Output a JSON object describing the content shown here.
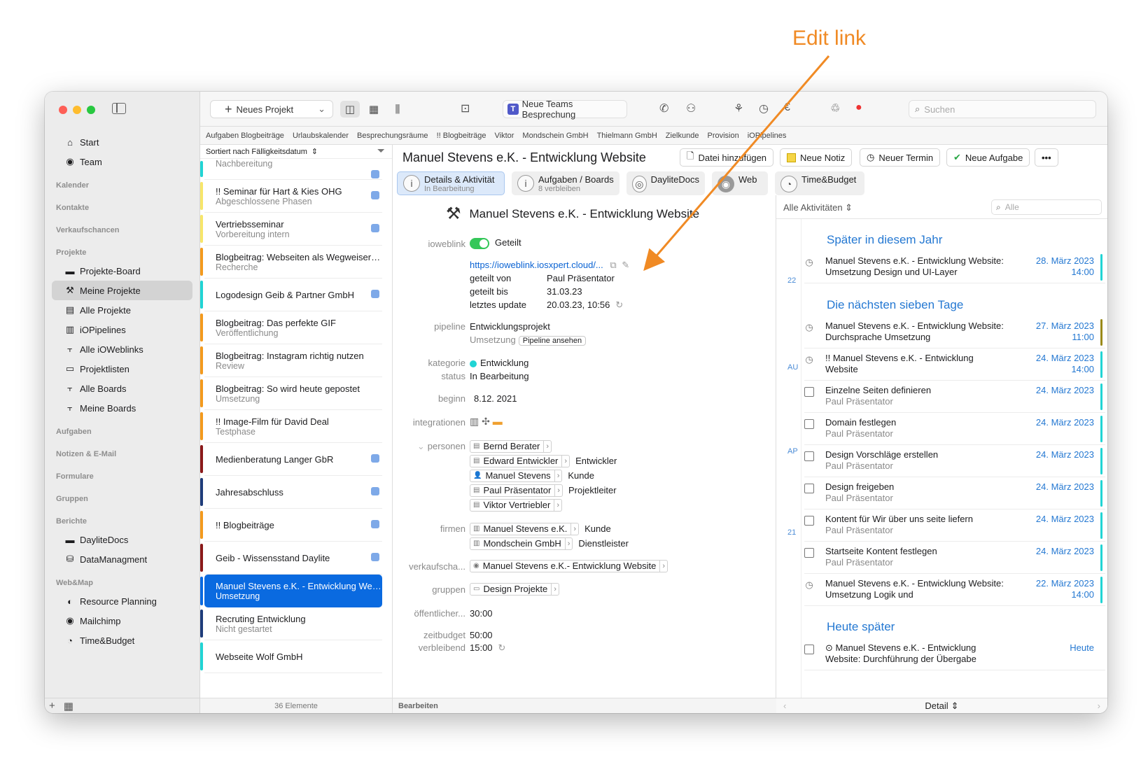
{
  "annotation": {
    "text": "Edit link"
  },
  "sidebar": {
    "items_top": [
      {
        "label": "Start",
        "icon": "home-icon"
      },
      {
        "label": "Team",
        "icon": "team-icon"
      }
    ],
    "headers": {
      "kalender": "Kalender",
      "kontakte": "Kontakte",
      "verkaufschancen": "Verkaufschancen",
      "projekte": "Projekte",
      "aufgaben": "Aufgaben",
      "notizen": "Notizen & E-Mail",
      "formulare": "Formulare",
      "gruppen": "Gruppen",
      "berichte": "Berichte",
      "webmap": "Web&Map"
    },
    "projekte": [
      {
        "label": "Projekte-Board"
      },
      {
        "label": "Meine Projekte"
      },
      {
        "label": "Alle Projekte"
      },
      {
        "label": "iOPipelines"
      },
      {
        "label": "Alle iOWeblinks"
      },
      {
        "label": "Projektlisten"
      },
      {
        "label": "Alle Boards"
      },
      {
        "label": "Meine Boards"
      }
    ],
    "berichte": [
      {
        "label": "DayliteDocs"
      },
      {
        "label": "DataManagment"
      }
    ],
    "webmap": [
      {
        "label": "Resource Planning"
      },
      {
        "label": "Mailchimp"
      },
      {
        "label": "Time&Budget"
      }
    ]
  },
  "toolbar": {
    "new_project": "Neues Projekt",
    "teams": "Neue Teams Besprechung",
    "search_placeholder": "Suchen"
  },
  "favorites": [
    "Aufgaben Blogbeiträge",
    "Urlaubskalender",
    "Besprechungsräume",
    "!! Blogbeiträge",
    "Viktor",
    "Mondschein GmbH",
    "Thielmann GmbH",
    "Zielkunde",
    "Provision",
    "iOPipelines"
  ],
  "list": {
    "sort": "Sortiert nach Fälligkeitsdatum",
    "footer": "36 Elemente",
    "rows": [
      {
        "t1": "",
        "t2": "Nachbereitung",
        "color": "#21d4d4",
        "badge": true
      },
      {
        "t1": "!! Seminar für Hart & Kies OHG",
        "t2": "Abgeschlossene Phasen",
        "color": "#f7e66b",
        "badge": true
      },
      {
        "t1": "Vertriebsseminar",
        "t2": "Vorbereitung intern",
        "color": "#f7e66b",
        "badge": true
      },
      {
        "t1": "Blogbeitrag: Webseiten als Wegweiser d...",
        "t2": "Recherche",
        "color": "#f39a1e",
        "badge": false
      },
      {
        "t1": "Logodesign Geib & Partner GmbH",
        "t2": "",
        "color": "#21d4d4",
        "badge": true
      },
      {
        "t1": "Blogbeitrag: Das perfekte GIF",
        "t2": "Veröffentlichung",
        "color": "#f39a1e",
        "badge": false
      },
      {
        "t1": "Blogbeitrag: Instagram richtig nutzen",
        "t2": "Review",
        "color": "#f39a1e",
        "badge": false
      },
      {
        "t1": "Blogbeitrag: So wird heute gepostet",
        "t2": "Umsetzung",
        "color": "#f39a1e",
        "badge": false
      },
      {
        "t1": "!! Image-Film für David Deal",
        "t2": "Testphase",
        "color": "#f39a1e",
        "badge": false
      },
      {
        "t1": "Medienberatung Langer GbR",
        "t2": "",
        "color": "#8b1a1a",
        "badge": true
      },
      {
        "t1": "Jahresabschluss",
        "t2": "",
        "color": "#1f3d7a",
        "badge": true
      },
      {
        "t1": "!! Blogbeiträge",
        "t2": "",
        "color": "#f39a1e",
        "badge": true
      },
      {
        "t1": "Geib - Wissensstand Daylite",
        "t2": "",
        "color": "#8b1a1a",
        "badge": true
      },
      {
        "t1": "Manuel Stevens e.K. - Entwicklung Webs...",
        "t2": "Umsetzung",
        "color": "#0a6ae0",
        "badge": false,
        "selected": true
      },
      {
        "t1": "Recruting Entwicklung",
        "t2": "Nicht gestartet",
        "color": "#1f3d7a",
        "badge": false
      },
      {
        "t1": "Webseite Wolf GmbH",
        "t2": "",
        "color": "#21d4d4",
        "badge": false
      }
    ]
  },
  "header": {
    "title": "Manuel Stevens e.K. - Entwicklung Website",
    "actions": [
      "Datei hinzufügen",
      "Neue Notiz",
      "Neuer Termin",
      "Neue Aufgabe"
    ]
  },
  "tabs": [
    {
      "l1": "Details & Aktivität",
      "l2": "In Bearbeitung"
    },
    {
      "l1": "Aufgaben / Boards",
      "l2": "8 verbleiben"
    },
    {
      "l1": "DayliteDocs",
      "l2": ""
    },
    {
      "l1": "Web",
      "l2": ""
    },
    {
      "l1": "Time&Budget",
      "l2": ""
    }
  ],
  "detail": {
    "heading": "Manuel Stevens e.K. - Entwicklung Website",
    "labels": {
      "ioweblink": "ioweblink",
      "pipeline": "pipeline",
      "kategorie": "kategorie",
      "status": "status",
      "beginn": "beginn",
      "integrationen": "integrationen",
      "personen": "personen",
      "firmen": "firmen",
      "verkaufschancen": "verkaufscha...",
      "gruppen": "gruppen",
      "oeffentlich": "öffentlicher...",
      "zeitbudget": "zeitbudget",
      "verbleibend": "verbleibend"
    },
    "ioweblink": {
      "state": "Geteilt",
      "url": "https://ioweblink.iosxpert.cloud/...",
      "geteilt_von_label": "geteilt von",
      "geteilt_von": "Paul Präsentator",
      "geteilt_bis_label": "geteilt bis",
      "geteilt_bis": "31.03.23",
      "update_label": "letztes update",
      "update": "20.03.23, 10:56"
    },
    "pipeline": "Entwicklungsprojekt",
    "pipeline_phase": "Umsetzung",
    "pipeline_button": "Pipeline ansehen",
    "kategorie": "Entwicklung",
    "status": "In Bearbeitung",
    "beginn": "8.12. 2021",
    "personen": [
      {
        "name": "Bernd Berater",
        "role": ""
      },
      {
        "name": "Edward Entwickler",
        "role": "Entwickler"
      },
      {
        "name": "Manuel Stevens",
        "role": "Kunde"
      },
      {
        "name": "Paul Präsentator",
        "role": "Projektleiter"
      },
      {
        "name": "Viktor Vertriebler",
        "role": ""
      }
    ],
    "firmen": [
      {
        "name": "Manuel Stevens e.K.",
        "role": "Kunde"
      },
      {
        "name": "Mondschein GmbH",
        "role": "Dienstleister"
      }
    ],
    "verkaufschance": "Manuel Stevens e.K.- Entwicklung Website",
    "gruppe": "Design Projekte",
    "oeffentlich": "30:00",
    "zeitbudget": "50:00",
    "verbleibend": "15:00",
    "footer": "Bearbeiten"
  },
  "activities": {
    "filter": "Alle Aktivitäten",
    "search_placeholder": "Alle",
    "timeline": [
      "22",
      "AU",
      "AP",
      "21"
    ],
    "sections": {
      "later_year": "Später in diesem Jahr",
      "next_seven": "Die nächsten sieben Tage",
      "today_later": "Heute später"
    },
    "later_year_items": [
      {
        "type": "appointment",
        "title": "Manuel Stevens e.K. - Entwicklung Website: Umsetzung Design und UI-Layer",
        "sub": "",
        "date": "28. März 2023",
        "time": "14:00",
        "bar": "#21d4d4"
      }
    ],
    "next_seven_items": [
      {
        "type": "appointment",
        "title": "Manuel Stevens e.K. - Entwicklung Website: Durchsprache Umsetzung",
        "sub": "",
        "date": "27. März 2023",
        "time": "11:00",
        "bar": "#9a8a1a"
      },
      {
        "type": "appointment",
        "title": "!! Manuel Stevens e.K. - Entwicklung Website",
        "sub": "",
        "date": "24. März 2023",
        "time": "14:00",
        "bar": "#21d4d4"
      },
      {
        "type": "task",
        "title": "Einzelne Seiten definieren",
        "sub": "Paul Präsentator",
        "date": "24. März 2023",
        "time": "",
        "bar": "#21d4d4"
      },
      {
        "type": "task",
        "title": "Domain festlegen",
        "sub": "Paul Präsentator",
        "date": "24. März 2023",
        "time": "",
        "bar": "#21d4d4"
      },
      {
        "type": "task",
        "title": "Design Vorschläge erstellen",
        "sub": "Paul Präsentator",
        "date": "24. März 2023",
        "time": "",
        "bar": "#21d4d4"
      },
      {
        "type": "task",
        "title": "Design freigeben",
        "sub": "Paul Präsentator",
        "date": "24. März 2023",
        "time": "",
        "bar": "#21d4d4"
      },
      {
        "type": "task",
        "title": "Kontent für Wir über uns seite liefern",
        "sub": "Paul Präsentator",
        "date": "24. März 2023",
        "time": "",
        "bar": "#21d4d4"
      },
      {
        "type": "task",
        "title": "Startseite Kontent festlegen",
        "sub": "Paul Präsentator",
        "date": "24. März 2023",
        "time": "",
        "bar": "#21d4d4"
      },
      {
        "type": "appointment",
        "title": "Manuel Stevens e.K. - Entwicklung Website: Umsetzung Logik und",
        "sub": "",
        "date": "22. März 2023",
        "time": "14:00",
        "bar": "#21d4d4"
      }
    ],
    "today_items": [
      {
        "type": "task",
        "title": "⊙ Manuel Stevens e.K. - Entwicklung Website: Durchführung der Übergabe",
        "sub": "",
        "date": "Heute",
        "time": "",
        "bar": ""
      }
    ],
    "footer": "Detail"
  }
}
